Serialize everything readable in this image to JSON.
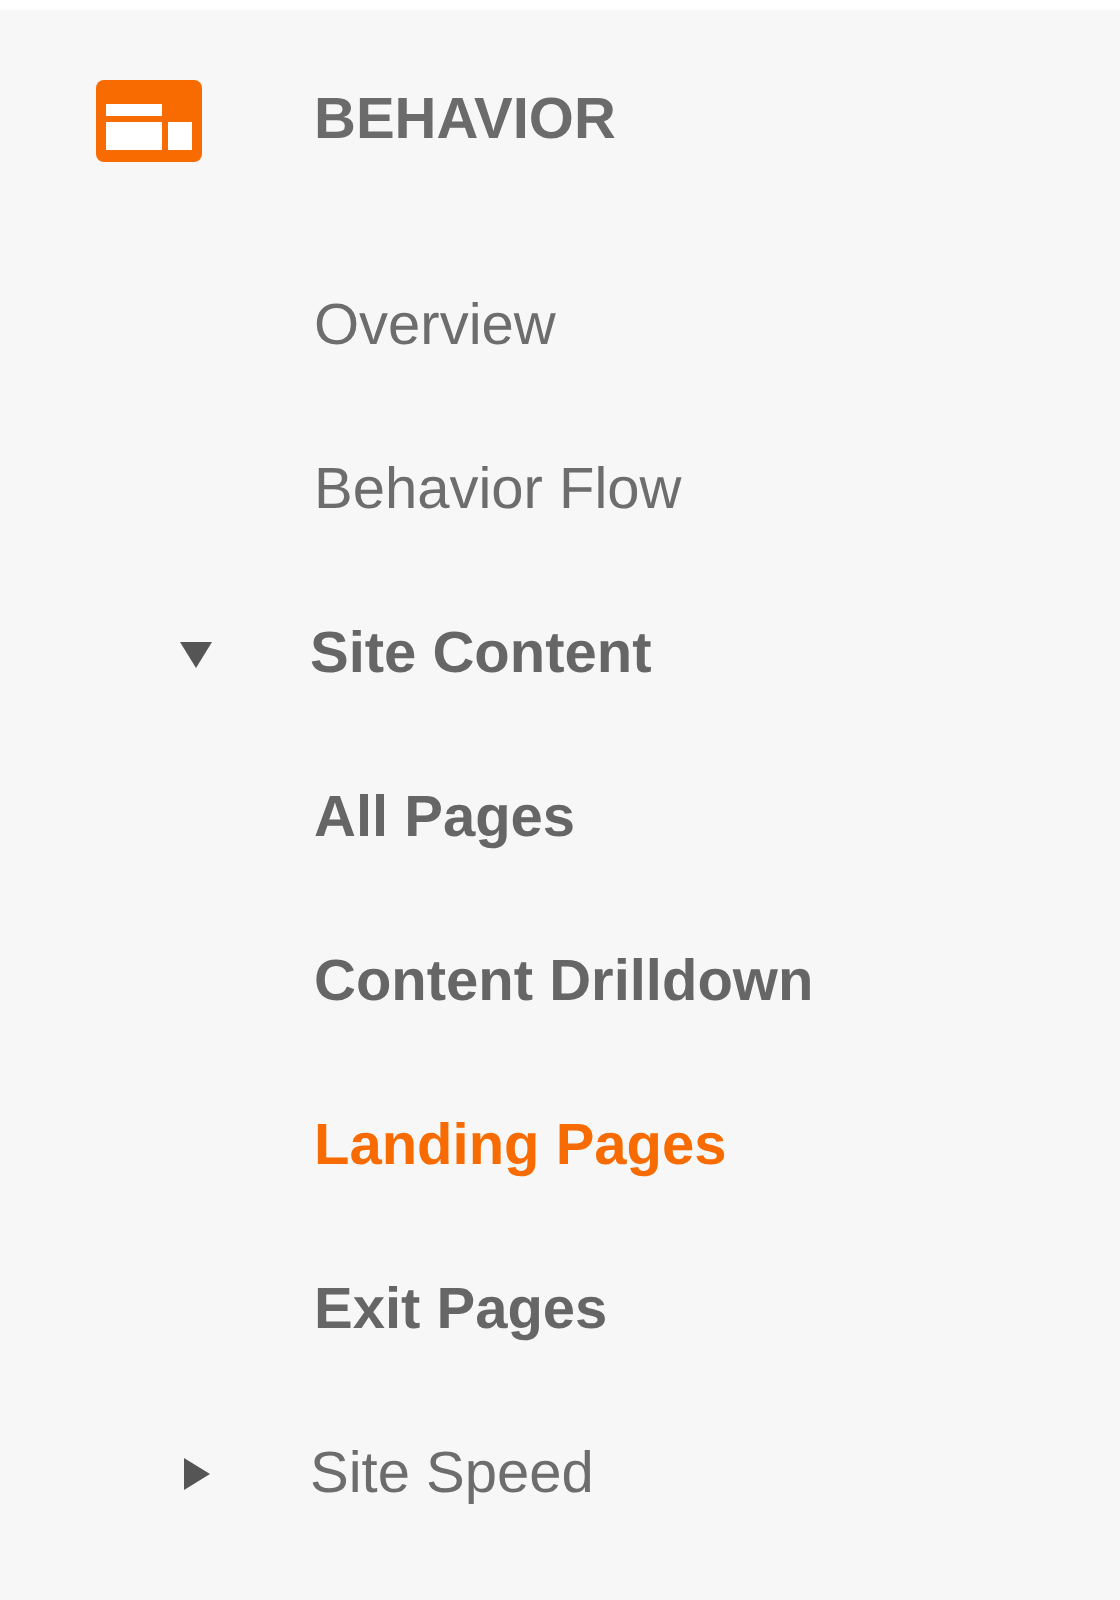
{
  "section": {
    "title": "BEHAVIOR"
  },
  "items": [
    {
      "label": "Overview",
      "kind": "link"
    },
    {
      "label": "Behavior Flow",
      "kind": "link"
    },
    {
      "label": "Site Content",
      "kind": "group",
      "expanded": true,
      "children": [
        {
          "label": "All Pages",
          "selected": false
        },
        {
          "label": "Content Drilldown",
          "selected": false
        },
        {
          "label": "Landing Pages",
          "selected": true
        },
        {
          "label": "Exit Pages",
          "selected": false
        }
      ]
    },
    {
      "label": "Site Speed",
      "kind": "group",
      "expanded": false
    }
  ]
}
